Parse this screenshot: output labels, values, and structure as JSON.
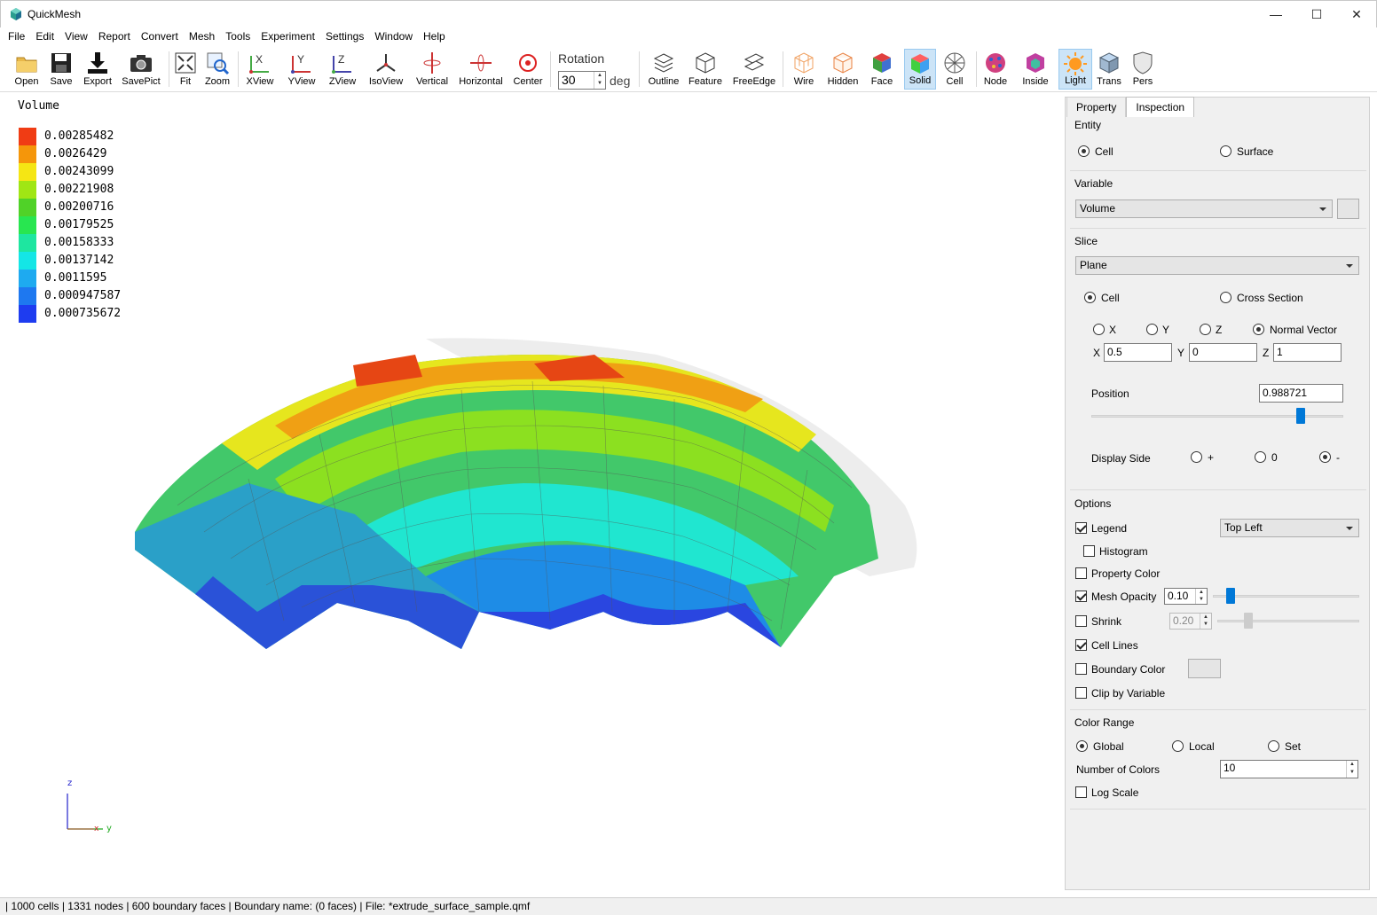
{
  "window": {
    "title": "QuickMesh",
    "minimize": "—",
    "maximize": "☐",
    "close": "✕"
  },
  "menu": [
    "File",
    "Edit",
    "View",
    "Report",
    "Convert",
    "Mesh",
    "Tools",
    "Experiment",
    "Settings",
    "Window",
    "Help"
  ],
  "toolbar": {
    "open": "Open",
    "save": "Save",
    "export": "Export",
    "savepict": "SavePict",
    "fit": "Fit",
    "zoom": "Zoom",
    "xview": "XView",
    "yview": "YView",
    "zview": "ZView",
    "isoview": "IsoView",
    "vertical": "Vertical",
    "horizontal": "Horizontal",
    "center": "Center",
    "rotation_label": "Rotation",
    "rotation_value": "30",
    "rotation_unit": "deg",
    "outline": "Outline",
    "feature": "Feature",
    "freeedge": "FreeEdge",
    "wire": "Wire",
    "hidden": "Hidden",
    "face": "Face",
    "solid": "Solid",
    "cell": "Cell",
    "node": "Node",
    "inside": "Inside",
    "light": "Light",
    "trans": "Trans",
    "pers": "Pers"
  },
  "legend": {
    "title": "Volume",
    "entries": [
      {
        "value": "0.00285482",
        "color": "#f03c14"
      },
      {
        "value": "0.0026429",
        "color": "#f5960a"
      },
      {
        "value": "0.00243099",
        "color": "#f5e614"
      },
      {
        "value": "0.00221908",
        "color": "#a0e614"
      },
      {
        "value": "0.00200716",
        "color": "#50d228"
      },
      {
        "value": "0.00179525",
        "color": "#28e650"
      },
      {
        "value": "0.00158333",
        "color": "#1ee6a0"
      },
      {
        "value": "0.00137142",
        "color": "#14e6e6"
      },
      {
        "value": "0.0011595",
        "color": "#1eaaf0"
      },
      {
        "value": "0.000947587",
        "color": "#1e78f0"
      },
      {
        "value": "0.000735672",
        "color": "#1e3cf0"
      }
    ]
  },
  "axes": {
    "z": "z",
    "x": "x",
    "y": "y"
  },
  "panel": {
    "tabs": [
      "Property",
      "Inspection"
    ],
    "entity": {
      "title": "Entity",
      "cell": "Cell",
      "surface": "Surface"
    },
    "variable": {
      "title": "Variable",
      "selected": "Volume"
    },
    "slice": {
      "title": "Slice",
      "mode": "Plane",
      "cell": "Cell",
      "cross_section": "Cross Section",
      "x": "X",
      "y": "Y",
      "z": "Z",
      "normal_vector": "Normal Vector",
      "nx_label": "X",
      "nx": "0.5",
      "ny_label": "Y",
      "ny": "0",
      "nz_label": "Z",
      "nz": "1",
      "position_label": "Position",
      "position": "0.988721",
      "position_level": 0.83,
      "display_side": "Display Side",
      "side_plus": "+",
      "side_zero": "0",
      "side_minus": "-"
    },
    "options": {
      "title": "Options",
      "legend": "Legend",
      "legend_pos": "Top Left",
      "histogram": "Histogram",
      "property_color": "Property Color",
      "mesh_opacity": "Mesh Opacity",
      "mesh_opacity_value": "0.10",
      "shrink": "Shrink",
      "shrink_value": "0.20",
      "cell_lines": "Cell Lines",
      "boundary_color": "Boundary Color",
      "clip_by_variable": "Clip by Variable"
    },
    "color_range": {
      "title": "Color Range",
      "global": "Global",
      "local": "Local",
      "set": "Set",
      "num_colors_label": "Number of Colors",
      "num_colors": "10",
      "log_scale": "Log Scale"
    }
  },
  "status": "| 1000 cells | 1331 nodes | 600 boundary faces |  Boundary name:  (0 faces) | File: *extrude_surface_sample.qmf"
}
